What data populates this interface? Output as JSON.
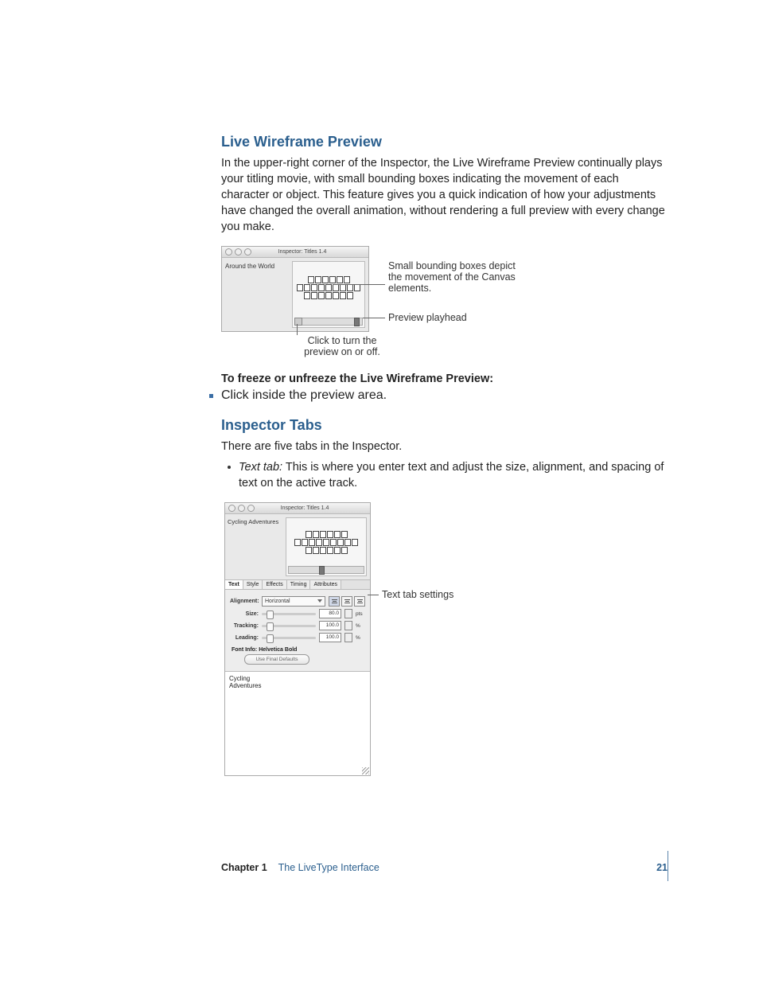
{
  "section1": {
    "heading": "Live Wireframe Preview",
    "paragraph": "In the upper-right corner of the Inspector, the Live Wireframe Preview continually plays your titling movie, with small bounding boxes indicating the movement of each character or object. This feature gives you a quick indication of how your adjustments have changed the overall animation, without rendering a full preview with every change you make.",
    "instruction_bold": "To freeze or unfreeze the Live Wireframe Preview:",
    "instruction_item": "Click inside the preview area."
  },
  "section2": {
    "heading": "Inspector Tabs",
    "intro": "There are five tabs in the Inspector.",
    "bullet_label": "Text tab:",
    "bullet_text": "  This is where you enter text and adjust the size, alignment, and spacing of text on the active track."
  },
  "fig1": {
    "window_title": "Inspector: Titles 1.4",
    "track_text": "Around the World",
    "callout_boxes": "Small bounding boxes depict the movement of the Canvas elements.",
    "callout_playhead": "Preview playhead",
    "callout_toggle": "Click to turn the preview on or off."
  },
  "fig2": {
    "window_title": "Inspector: Titles 1.4",
    "track_text": "Cycling Adventures",
    "tabs": [
      "Text",
      "Style",
      "Effects",
      "Timing",
      "Attributes"
    ],
    "rows": {
      "alignment_label": "Alignment:",
      "alignment_value": "Horizontal",
      "size_label": "Size:",
      "size_value": "80.0",
      "size_unit": "pts",
      "tracking_label": "Tracking:",
      "tracking_value": "100.0",
      "tracking_unit": "%",
      "leading_label": "Leading:",
      "leading_value": "100.0",
      "leading_unit": "%"
    },
    "font_info": "Font Info: Helvetica Bold",
    "defaults_button": "Use Final Defaults",
    "textarea_text": "Cycling\nAdventures",
    "callout_settings": "Text tab settings"
  },
  "footer": {
    "chapter": "Chapter 1",
    "title": "The LiveType Interface",
    "page": "21"
  }
}
